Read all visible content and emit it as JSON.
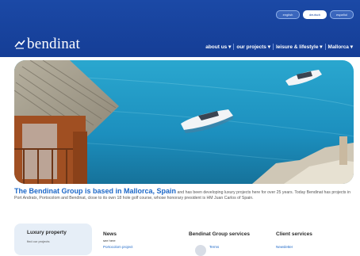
{
  "header": {
    "brand": "bendinat",
    "language_buttons": [
      "english",
      "deutsch",
      "español"
    ],
    "nav": [
      {
        "label": "about us ▾"
      },
      {
        "label": "our projects ▾"
      },
      {
        "label": "leisure & lifestyle ▾"
      },
      {
        "label": "Mallorca ▾"
      }
    ]
  },
  "intro": {
    "title": "The Bendinat Group is based in Mallorca, Spain",
    "text": " and has been developing luxury projects here for over 25 years. Today Bendinat has projects in Port Andratx, Portocolom and Bendinat, close to its own 18 hole golf course, whose honorary president is HM Juan Carlos of Spain."
  },
  "bottom": {
    "card_title": "Luxury property",
    "card_sub": "find our projects",
    "columns": [
      {
        "title": "News",
        "sub": "see here",
        "link": "Portocolom project"
      },
      {
        "title": "Bendinat Group services",
        "link": "Terms"
      },
      {
        "title": "Client services",
        "link": "Newsletter"
      }
    ]
  },
  "colors": {
    "header_blue": "#1b49a6",
    "link_blue": "#1d68c8",
    "sea": "#1c8fbe"
  }
}
